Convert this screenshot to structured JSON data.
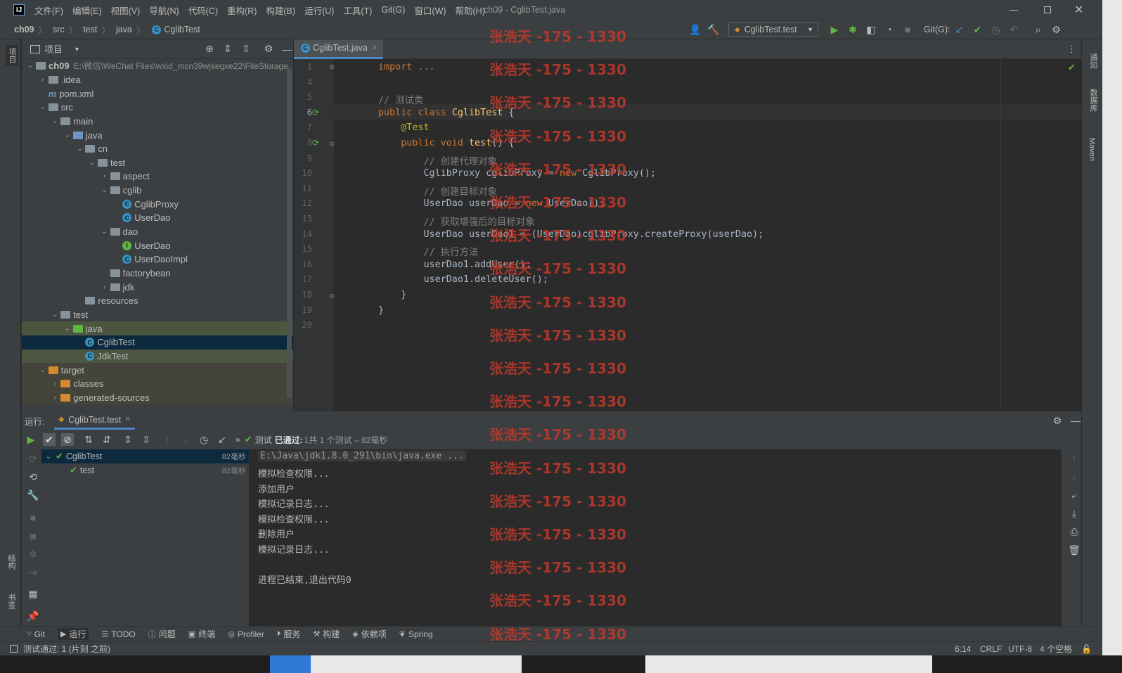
{
  "app": {
    "window_title": "ch09 - CglibTest.java",
    "menu": [
      "文件(F)",
      "编辑(E)",
      "视图(V)",
      "导航(N)",
      "代码(C)",
      "重构(R)",
      "构建(B)",
      "运行(U)",
      "工具(T)",
      "Git(G)",
      "窗口(W)",
      "帮助(H)"
    ]
  },
  "breadcrumb": [
    "ch09",
    "src",
    "test",
    "java",
    "CglibTest"
  ],
  "toolbar": {
    "run_config": "CglibTest.test",
    "git_label": "Git(G):"
  },
  "project": {
    "title": "项目",
    "root_name": "ch09",
    "root_path": "E:\\微信\\WeChat Files\\wxid_mcn39wjsegxe22\\FileStorage",
    "tree": [
      ".idea",
      "pom.xml",
      "src",
      "main",
      "java",
      "cn",
      "test",
      "aspect",
      "cglib",
      "CglibProxy",
      "UserDao",
      "dao",
      "UserDao",
      "UserDaoImpl",
      "factorybean",
      "jdk",
      "resources",
      "test",
      "java",
      "CglibTest",
      "JdkTest",
      "target",
      "classes",
      "generated-sources"
    ]
  },
  "editor": {
    "tab": "CglibTest.java",
    "line_numbers": [
      "1",
      "4",
      "5",
      "6",
      "7",
      "8",
      "9",
      "10",
      "11",
      "12",
      "13",
      "14",
      "15",
      "16",
      "17",
      "18",
      "19",
      "20"
    ],
    "lines": [
      "import ...",
      "",
      "// 测试类",
      "public class CglibTest {",
      "    @Test",
      "    public void test() {",
      "        // 创建代理对象",
      "        CglibProxy cglibProxy = new CglibProxy();",
      "        // 创建目标对象",
      "        UserDao userDao = new UserDao();",
      "        // 获取增强后的目标对象",
      "        UserDao userDao1 = (UserDao)cglibProxy.createProxy(userDao);",
      "        // 执行方法",
      "        userDao1.addUser();",
      "        userDao1.deleteUser();",
      "    }",
      "}",
      ""
    ]
  },
  "run": {
    "label": "运行:",
    "tab": "CglibTest.test",
    "status_prefix": "测试",
    "status_passed": "已通过:",
    "status_count": "1共 1 个测试 – 82毫秒",
    "tests": [
      {
        "name": "CglibTest",
        "time": "82毫秒"
      },
      {
        "name": "test",
        "time": "82毫秒"
      }
    ],
    "console": [
      "E:\\Java\\jdk1.8.0_291\\bin\\java.exe ...",
      "模拟检查权限...",
      "添加用户",
      "模拟记录日志...",
      "模拟检查权限...",
      "删除用户",
      "模拟记录日志...",
      "",
      "进程已结束,退出代码0"
    ]
  },
  "bottom_tabs": [
    "Git",
    "运行",
    "TODO",
    "问题",
    "终端",
    "Profiler",
    "服务",
    "构建",
    "依赖项",
    "Spring"
  ],
  "status": {
    "message": "测试通过: 1 (片刻 之前)",
    "position": "6:14",
    "line_sep": "CRLF",
    "encoding": "UTF-8",
    "indent": "4 个空格"
  },
  "side_labels": {
    "left_top": "项目",
    "left_mid": "结构",
    "left_bottom": "书签",
    "right_notify": "通知",
    "right_db": "数据库",
    "right_maven": "Maven"
  },
  "watermark": "张浩天 -175 - 1330",
  "colors": {
    "accent": "#3592c4",
    "pass": "#62b543",
    "watermark": "#c0392b"
  }
}
